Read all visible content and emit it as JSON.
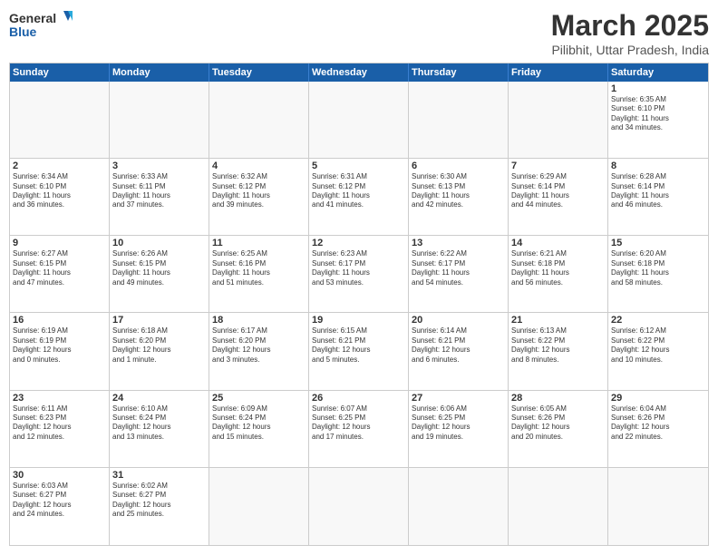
{
  "header": {
    "logo_general": "General",
    "logo_blue": "Blue",
    "month_title": "March 2025",
    "location": "Pilibhit, Uttar Pradesh, India"
  },
  "weekdays": [
    "Sunday",
    "Monday",
    "Tuesday",
    "Wednesday",
    "Thursday",
    "Friday",
    "Saturday"
  ],
  "rows": [
    [
      {
        "day": "",
        "text": ""
      },
      {
        "day": "",
        "text": ""
      },
      {
        "day": "",
        "text": ""
      },
      {
        "day": "",
        "text": ""
      },
      {
        "day": "",
        "text": ""
      },
      {
        "day": "",
        "text": ""
      },
      {
        "day": "1",
        "text": "Sunrise: 6:35 AM\nSunset: 6:10 PM\nDaylight: 11 hours\nand 34 minutes."
      }
    ],
    [
      {
        "day": "2",
        "text": "Sunrise: 6:34 AM\nSunset: 6:10 PM\nDaylight: 11 hours\nand 36 minutes."
      },
      {
        "day": "3",
        "text": "Sunrise: 6:33 AM\nSunset: 6:11 PM\nDaylight: 11 hours\nand 37 minutes."
      },
      {
        "day": "4",
        "text": "Sunrise: 6:32 AM\nSunset: 6:12 PM\nDaylight: 11 hours\nand 39 minutes."
      },
      {
        "day": "5",
        "text": "Sunrise: 6:31 AM\nSunset: 6:12 PM\nDaylight: 11 hours\nand 41 minutes."
      },
      {
        "day": "6",
        "text": "Sunrise: 6:30 AM\nSunset: 6:13 PM\nDaylight: 11 hours\nand 42 minutes."
      },
      {
        "day": "7",
        "text": "Sunrise: 6:29 AM\nSunset: 6:14 PM\nDaylight: 11 hours\nand 44 minutes."
      },
      {
        "day": "8",
        "text": "Sunrise: 6:28 AM\nSunset: 6:14 PM\nDaylight: 11 hours\nand 46 minutes."
      }
    ],
    [
      {
        "day": "9",
        "text": "Sunrise: 6:27 AM\nSunset: 6:15 PM\nDaylight: 11 hours\nand 47 minutes."
      },
      {
        "day": "10",
        "text": "Sunrise: 6:26 AM\nSunset: 6:15 PM\nDaylight: 11 hours\nand 49 minutes."
      },
      {
        "day": "11",
        "text": "Sunrise: 6:25 AM\nSunset: 6:16 PM\nDaylight: 11 hours\nand 51 minutes."
      },
      {
        "day": "12",
        "text": "Sunrise: 6:23 AM\nSunset: 6:17 PM\nDaylight: 11 hours\nand 53 minutes."
      },
      {
        "day": "13",
        "text": "Sunrise: 6:22 AM\nSunset: 6:17 PM\nDaylight: 11 hours\nand 54 minutes."
      },
      {
        "day": "14",
        "text": "Sunrise: 6:21 AM\nSunset: 6:18 PM\nDaylight: 11 hours\nand 56 minutes."
      },
      {
        "day": "15",
        "text": "Sunrise: 6:20 AM\nSunset: 6:18 PM\nDaylight: 11 hours\nand 58 minutes."
      }
    ],
    [
      {
        "day": "16",
        "text": "Sunrise: 6:19 AM\nSunset: 6:19 PM\nDaylight: 12 hours\nand 0 minutes."
      },
      {
        "day": "17",
        "text": "Sunrise: 6:18 AM\nSunset: 6:20 PM\nDaylight: 12 hours\nand 1 minute."
      },
      {
        "day": "18",
        "text": "Sunrise: 6:17 AM\nSunset: 6:20 PM\nDaylight: 12 hours\nand 3 minutes."
      },
      {
        "day": "19",
        "text": "Sunrise: 6:15 AM\nSunset: 6:21 PM\nDaylight: 12 hours\nand 5 minutes."
      },
      {
        "day": "20",
        "text": "Sunrise: 6:14 AM\nSunset: 6:21 PM\nDaylight: 12 hours\nand 6 minutes."
      },
      {
        "day": "21",
        "text": "Sunrise: 6:13 AM\nSunset: 6:22 PM\nDaylight: 12 hours\nand 8 minutes."
      },
      {
        "day": "22",
        "text": "Sunrise: 6:12 AM\nSunset: 6:22 PM\nDaylight: 12 hours\nand 10 minutes."
      }
    ],
    [
      {
        "day": "23",
        "text": "Sunrise: 6:11 AM\nSunset: 6:23 PM\nDaylight: 12 hours\nand 12 minutes."
      },
      {
        "day": "24",
        "text": "Sunrise: 6:10 AM\nSunset: 6:24 PM\nDaylight: 12 hours\nand 13 minutes."
      },
      {
        "day": "25",
        "text": "Sunrise: 6:09 AM\nSunset: 6:24 PM\nDaylight: 12 hours\nand 15 minutes."
      },
      {
        "day": "26",
        "text": "Sunrise: 6:07 AM\nSunset: 6:25 PM\nDaylight: 12 hours\nand 17 minutes."
      },
      {
        "day": "27",
        "text": "Sunrise: 6:06 AM\nSunset: 6:25 PM\nDaylight: 12 hours\nand 19 minutes."
      },
      {
        "day": "28",
        "text": "Sunrise: 6:05 AM\nSunset: 6:26 PM\nDaylight: 12 hours\nand 20 minutes."
      },
      {
        "day": "29",
        "text": "Sunrise: 6:04 AM\nSunset: 6:26 PM\nDaylight: 12 hours\nand 22 minutes."
      }
    ],
    [
      {
        "day": "30",
        "text": "Sunrise: 6:03 AM\nSunset: 6:27 PM\nDaylight: 12 hours\nand 24 minutes."
      },
      {
        "day": "31",
        "text": "Sunrise: 6:02 AM\nSunset: 6:27 PM\nDaylight: 12 hours\nand 25 minutes."
      },
      {
        "day": "",
        "text": ""
      },
      {
        "day": "",
        "text": ""
      },
      {
        "day": "",
        "text": ""
      },
      {
        "day": "",
        "text": ""
      },
      {
        "day": "",
        "text": ""
      }
    ]
  ]
}
